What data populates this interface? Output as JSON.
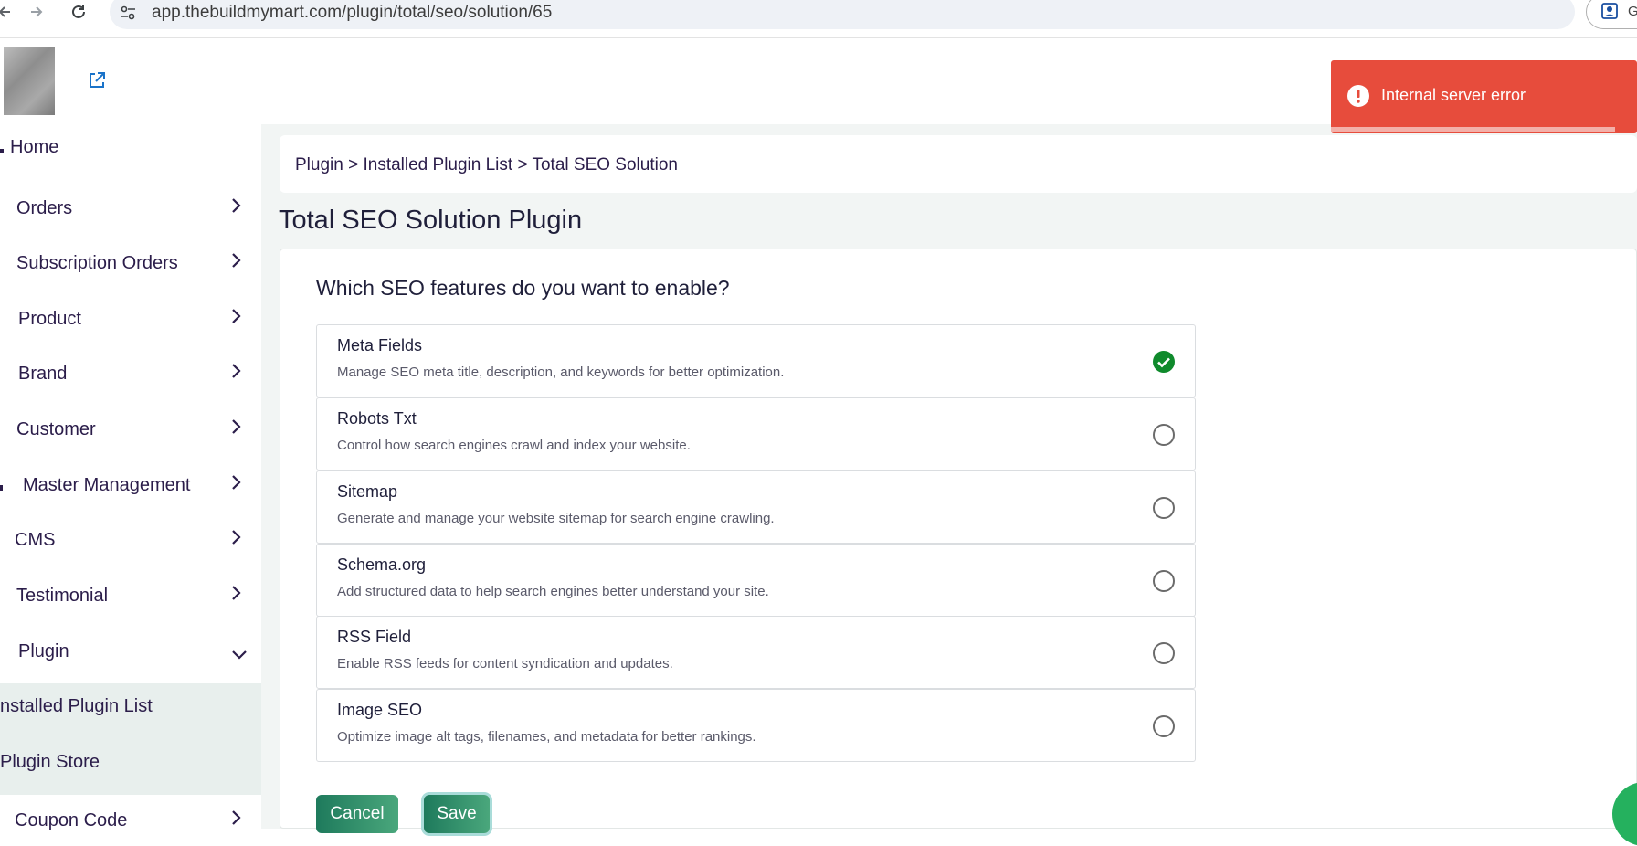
{
  "browser": {
    "url": "app.thebuildmymart.com/plugin/total/seo/solution/65",
    "profile_label": "G"
  },
  "sidebar": {
    "items": [
      {
        "label": "Home"
      },
      {
        "label": "Orders"
      },
      {
        "label": "Subscription Orders"
      },
      {
        "label": "Product"
      },
      {
        "label": "Brand"
      },
      {
        "label": "Customer"
      },
      {
        "label": "Master Management"
      },
      {
        "label": "CMS"
      },
      {
        "label": "Testimonial"
      },
      {
        "label": "Plugin",
        "expanded": true
      },
      {
        "label": "nstalled Plugin List"
      },
      {
        "label": "Plugin Store"
      },
      {
        "label": "Coupon Code"
      }
    ]
  },
  "breadcrumb": "Plugin > Installed Plugin List > Total SEO Solution",
  "page_title": "Total SEO Solution Plugin",
  "question": "Which SEO features do you want to enable?",
  "options": [
    {
      "title": "Meta Fields",
      "description": "Manage SEO meta title, description, and keywords for better optimization.",
      "selected": true
    },
    {
      "title": "Robots Txt",
      "description": "Control how search engines crawl and index your website.",
      "selected": false
    },
    {
      "title": "Sitemap",
      "description": "Generate and manage your website sitemap for search engine crawling.",
      "selected": false
    },
    {
      "title": "Schema.org",
      "description": "Add structured data to help search engines better understand your site.",
      "selected": false
    },
    {
      "title": "RSS Field",
      "description": "Enable RSS feeds for content syndication and updates.",
      "selected": false
    },
    {
      "title": "Image SEO",
      "description": "Optimize image alt tags, filenames, and metadata for better rankings.",
      "selected": false
    }
  ],
  "buttons": {
    "cancel": "Cancel",
    "save": "Save"
  },
  "toast": {
    "message": "Internal server error",
    "color": "#e74c3c"
  },
  "colors": {
    "accent": "#1e7a5c",
    "check": "#0f8a2c"
  }
}
